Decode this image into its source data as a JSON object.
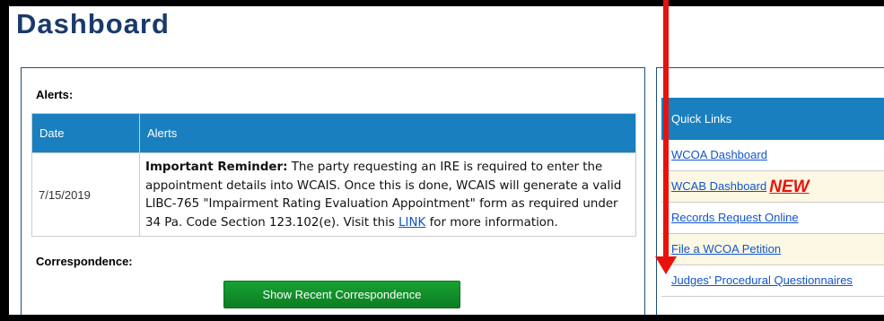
{
  "page": {
    "title": "Dashboard"
  },
  "alerts": {
    "section_label": "Alerts:",
    "columns": {
      "date": "Date",
      "alerts": "Alerts"
    },
    "rows": [
      {
        "date": "7/15/2019",
        "lead": "Important Reminder:",
        "text_before_link": " The party requesting an IRE is required to enter the appointment details into WCAIS.  Once this is done, WCAIS will generate a valid LIBC-765 \"Impairment Rating Evaluation Appointment\" form as required under 34 Pa. Code Section 123.102(e).  Visit this ",
        "link_text": "LINK",
        "text_after_link": " for more information."
      }
    ]
  },
  "correspondence": {
    "section_label": "Correspondence:",
    "button_label": "Show Recent Correspondence"
  },
  "quick_links": {
    "header": "Quick Links",
    "items": [
      {
        "label": "WCOA Dashboard",
        "badge": ""
      },
      {
        "label": "WCAB Dashboard",
        "badge": "NEW"
      },
      {
        "label": "Records Request Online",
        "badge": ""
      },
      {
        "label": "File a WCOA Petition",
        "badge": ""
      },
      {
        "label": "Judges' Procedural Questionnaires",
        "badge": ""
      }
    ]
  },
  "colors": {
    "title": "#1a3a6b",
    "table_header": "#1a7fbf",
    "button": "#129a2c",
    "badge_new": "#e8120c",
    "annotation_arrow": "#e8120c"
  },
  "annotation": {
    "icon": "red-down-arrow-icon"
  }
}
